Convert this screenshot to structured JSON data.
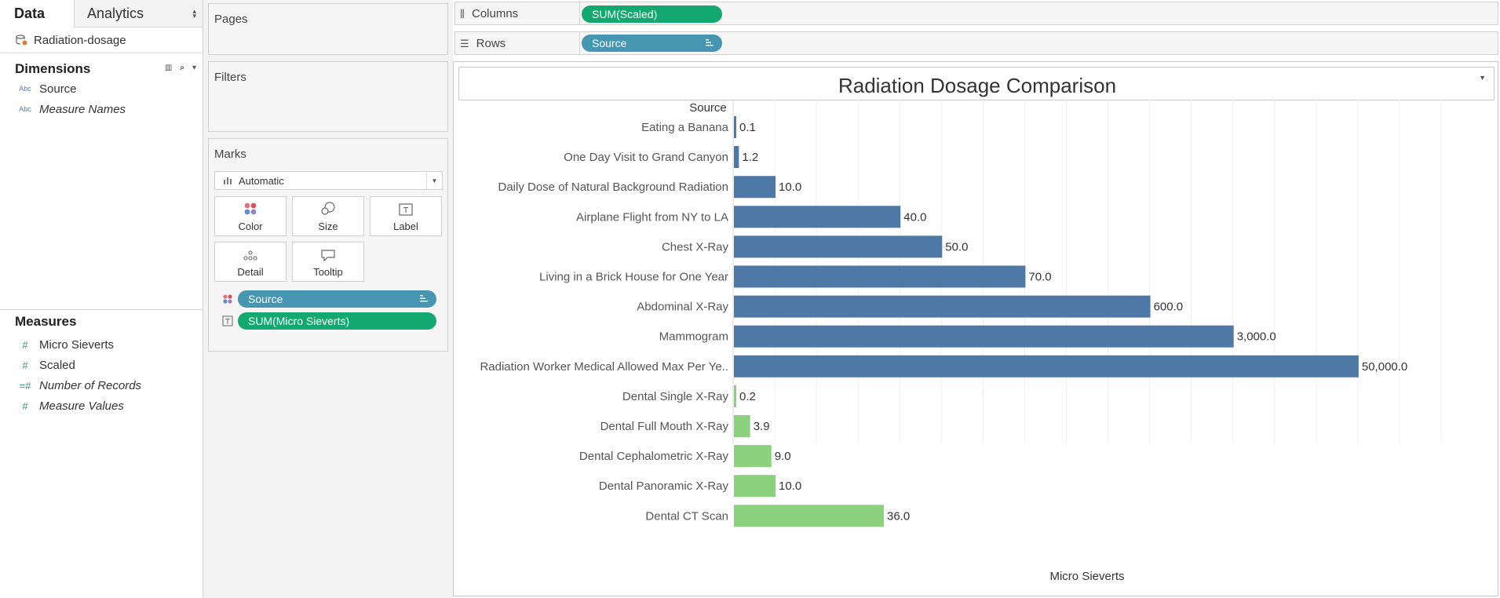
{
  "left_pane": {
    "tabs": [
      "Data",
      "Analytics"
    ],
    "datasource": "Radiation-dosage",
    "dimensions_label": "Dimensions",
    "dimensions": [
      {
        "name": "Source",
        "type": "Abc",
        "italic": false
      },
      {
        "name": "Measure Names",
        "type": "Abc",
        "italic": true
      }
    ],
    "measures_label": "Measures",
    "measures": [
      {
        "name": "Micro Sieverts",
        "italic": false
      },
      {
        "name": "Scaled",
        "italic": false
      },
      {
        "name": "Number of Records",
        "italic": true
      },
      {
        "name": "Measure Values",
        "italic": true
      }
    ]
  },
  "cards": {
    "pages": "Pages",
    "filters": "Filters",
    "marks": "Marks",
    "mark_type": "Automatic",
    "buttons": {
      "color": "Color",
      "size": "Size",
      "label": "Label",
      "detail": "Detail",
      "tooltip": "Tooltip"
    },
    "pills": {
      "source": "Source",
      "sum": "SUM(Micro Sieverts)"
    }
  },
  "shelves": {
    "columns_label": "Columns",
    "columns_pill": "SUM(Scaled)",
    "rows_label": "Rows",
    "rows_pill": "Source"
  },
  "colors": {
    "blue_bar": "#4e79a7",
    "green_bar": "#8cd17d",
    "pill_blue": "#4796b1",
    "pill_green": "#13a870"
  },
  "chart_data": {
    "type": "bar",
    "orientation": "horizontal",
    "title": "Radiation Dosage Comparison",
    "row_header": "Source",
    "xlabel": "Micro Sieverts",
    "grid": true,
    "categories": [
      "Eating a Banana",
      "One Day Visit to Grand Canyon",
      "Daily Dose of Natural Background Radiation",
      "Airplane Flight from NY to LA",
      "Chest X-Ray",
      "Living in a Brick House for One Year",
      "Abdominal X-Ray",
      "Mammogram",
      "Radiation Worker Medical Allowed Max Per Ye..",
      "Dental Single X-Ray",
      "Dental Full Mouth X-Ray",
      "Dental Cephalometric X-Ray",
      "Dental Panoramic X-Ray",
      "Dental CT Scan"
    ],
    "labels": [
      "0.1",
      "1.2",
      "10.0",
      "40.0",
      "50.0",
      "70.0",
      "600.0",
      "3,000.0",
      "50,000.0",
      "0.2",
      "3.9",
      "9.0",
      "10.0",
      "36.0"
    ],
    "scaled_values": [
      0.1,
      1.2,
      10.0,
      40.0,
      50.0,
      70.0,
      100.0,
      120.0,
      150.0,
      0.2,
      3.9,
      9.0,
      10.0,
      36.0
    ],
    "color_group": [
      "blue",
      "blue",
      "blue",
      "blue",
      "blue",
      "blue",
      "blue",
      "blue",
      "blue",
      "green",
      "green",
      "green",
      "green",
      "green"
    ],
    "xlim": [
      0,
      170
    ]
  }
}
